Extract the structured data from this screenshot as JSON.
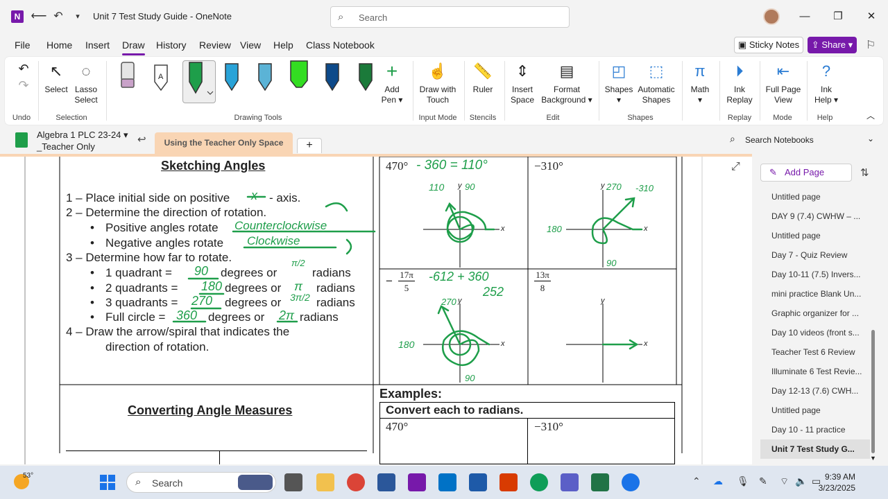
{
  "titlebar": {
    "app_letter": "N",
    "doc_title": "Unit 7 Test Study Guide  -  OneNote",
    "search_placeholder": "Search"
  },
  "menu": {
    "items": [
      "File",
      "Home",
      "Insert",
      "Draw",
      "History",
      "Review",
      "View",
      "Help",
      "Class Notebook"
    ],
    "active": "Draw",
    "sticky_notes": "Sticky Notes",
    "share": "Share"
  },
  "ribbon": {
    "undo_group": "Undo",
    "select": "Select",
    "lasso": "Lasso",
    "lasso2": "Select",
    "selection_group": "Selection",
    "drawing_tools_group": "Drawing Tools",
    "add_pen": "Add",
    "add_pen2": "Pen",
    "draw_touch": "Draw with",
    "draw_touch2": "Touch",
    "input_mode_group": "Input Mode",
    "ruler": "Ruler",
    "stencils_group": "Stencils",
    "insert_space": "Insert",
    "insert_space2": "Space",
    "format_bg": "Format",
    "format_bg2": "Background",
    "edit_group": "Edit",
    "shapes": "Shapes",
    "auto_shapes": "Automatic",
    "auto_shapes2": "Shapes",
    "shapes_group": "Shapes",
    "math": "Math",
    "ink_replay": "Ink",
    "ink_replay2": "Replay",
    "replay_group": "Replay",
    "full_page": "Full Page",
    "full_page2": "View",
    "mode_group": "Mode",
    "ink_help": "Ink",
    "ink_help2": "Help",
    "help_group": "Help",
    "pen_colors": [
      "#c9a2c9",
      "#ffffff",
      "#1e9e4a",
      "#29a3d8",
      "#5bb3d6",
      "#33dd22",
      "#0d4a8a",
      "#1b7a3a"
    ]
  },
  "notebook": {
    "name_line1": "Algebra 1 PLC 23-24",
    "name_line2": "_Teacher Only",
    "section_tab": "Using the Teacher Only Space",
    "search_notebooks": "Search Notebooks"
  },
  "pages": {
    "add_page": "Add Page",
    "items": [
      "Untitled page",
      "DAY 9 (7.4) CWHW – ...",
      "Untitled page",
      "Day 7 - Quiz Review",
      "Day 10-11 (7.5) Invers...",
      "mini practice Blank Un...",
      "Graphic organizer for ...",
      "Day 10 videos (front s...",
      "Teacher Test 6 Review",
      "Illuminate 6 Test Revie...",
      "Day 12-13 (7.6) CWH...",
      "Untitled page",
      "Day 10 - 11 practice",
      "Unit 7 Test Study G..."
    ],
    "active_index": 13
  },
  "content": {
    "heading": "Sketching Angles",
    "steps": [
      "1 – Place initial side on positive",
      "- axis.",
      "2 – Determine the direction of rotation.",
      "Positive angles rotate",
      "Negative angles rotate",
      "3 – Determine how far to rotate.",
      "1 quadrant =",
      "degrees or",
      "radians",
      "2 quadrants =",
      "degrees or",
      "radians",
      "3 quadrants =",
      "degrees or",
      "radians",
      "Full circle =",
      "degrees or",
      "radians",
      "4 – Draw the arrow/spiral that indicates the",
      "direction of rotation."
    ],
    "handwriting": {
      "x": "x",
      "counterclockwise": "Counterclockwise",
      "clockwise": "Clockwise",
      "q1_deg": "90",
      "q1_rad": "π/2",
      "q2_deg": "180",
      "q2_rad": "π",
      "q3_deg": "270",
      "q3_rad": "3π/2",
      "full_deg": "360",
      "full_rad": "2π"
    },
    "graphs": {
      "g1_label": "470°",
      "g1_hand": "- 360 = 110°",
      "g2_label": "−310°",
      "g3_label_num": "17π",
      "g3_label_den": "5",
      "g3_minus": "−",
      "g3_hand1": "-612 + 360",
      "g3_hand2": "252",
      "g4_label_num": "13π",
      "g4_label_den": "8",
      "axis_x": "x",
      "axis_y": "y",
      "ann_110": "110",
      "ann_90": "90",
      "ann_270": "270",
      "ann_neg310": "-310",
      "ann_180": "180",
      "ann_90b": "90",
      "ann_270b": "270",
      "ann_180b": "180",
      "ann_90c": "90"
    },
    "heading2": "Converting Angle Measures",
    "examples": "Examples:",
    "convert": "Convert each to radians.",
    "ex1": "470°",
    "ex2": "−310°"
  },
  "taskbar": {
    "temp": "53°",
    "search": "Search",
    "time": "9:39 AM",
    "date": "3/23/2025"
  }
}
